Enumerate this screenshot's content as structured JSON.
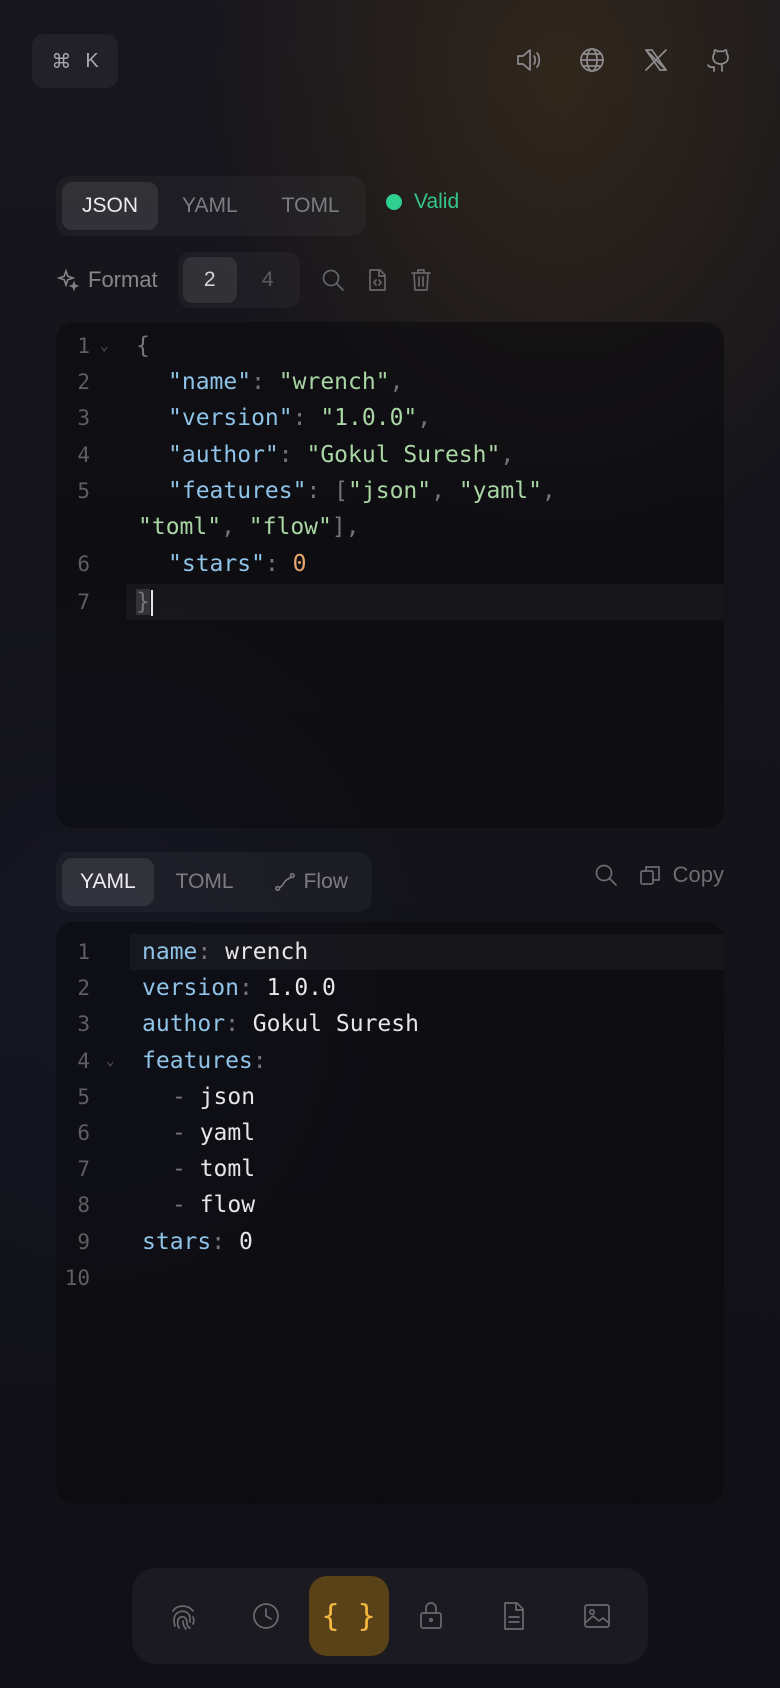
{
  "top": {
    "cmdk": {
      "symbol": "⌘",
      "key": "K"
    },
    "icons": [
      "speaker-icon",
      "globe-icon",
      "x-logo-icon",
      "github-icon"
    ]
  },
  "input": {
    "tabs": [
      "JSON",
      "YAML",
      "TOML"
    ],
    "active_tab": "JSON",
    "status": "Valid",
    "status_color": "#2fd08f",
    "format_label": "Format",
    "indent_options": [
      "2",
      "4"
    ],
    "active_indent": "2",
    "line_numbers": [
      "1",
      "2",
      "3",
      "4",
      "5",
      "6",
      "7"
    ],
    "code": {
      "open": "{",
      "name_key": "\"name\"",
      "name_val": "\"wrench\"",
      "version_key": "\"version\"",
      "version_val": "\"1.0.0\"",
      "author_key": "\"author\"",
      "author_val": "\"Gokul Suresh\"",
      "features_key": "\"features\"",
      "f1": "\"json\"",
      "f2": "\"yaml\"",
      "f3": "\"toml\"",
      "f4": "\"flow\"",
      "stars_key": "\"stars\"",
      "stars_val": "0",
      "close": "}"
    }
  },
  "output": {
    "tabs": [
      "YAML",
      "TOML",
      "Flow"
    ],
    "active_tab": "YAML",
    "copy_label": "Copy",
    "line_numbers": [
      "1",
      "2",
      "3",
      "4",
      "5",
      "6",
      "7",
      "8",
      "9",
      "10"
    ],
    "code": {
      "name_key": "name",
      "name_val": "wrench",
      "version_key": "version",
      "version_val": "1.0.0",
      "author_key": "author",
      "author_val": "Gokul Suresh",
      "features_key": "features",
      "items": [
        "json",
        "yaml",
        "toml",
        "flow"
      ],
      "stars_key": "stars",
      "stars_val": "0"
    }
  },
  "nav": {
    "items": [
      "fingerprint-icon",
      "history-icon",
      "braces-icon",
      "lock-icon",
      "document-icon",
      "image-icon"
    ],
    "active_symbol": "{ }",
    "active_color": "#f4b740"
  }
}
